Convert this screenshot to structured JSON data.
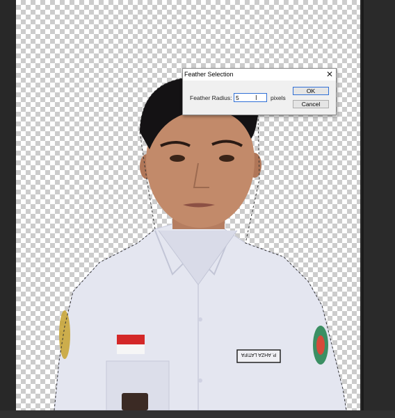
{
  "dialog": {
    "title": "Feather Selection",
    "close_glyph": "✕",
    "field_label": "Feather Radius:",
    "field_value": "5",
    "unit_label": "pixels",
    "ok_label": "OK",
    "cancel_label": "Cancel"
  },
  "canvas": {
    "badge_text": "P. AHZA LATIFA",
    "transparency_pattern": "checkerboard"
  },
  "colors": {
    "dialog_bg": "#f0f0f0",
    "accent": "#2f6fd6",
    "workspace_bg": "#282828",
    "shirt": "#e6e8f2"
  }
}
